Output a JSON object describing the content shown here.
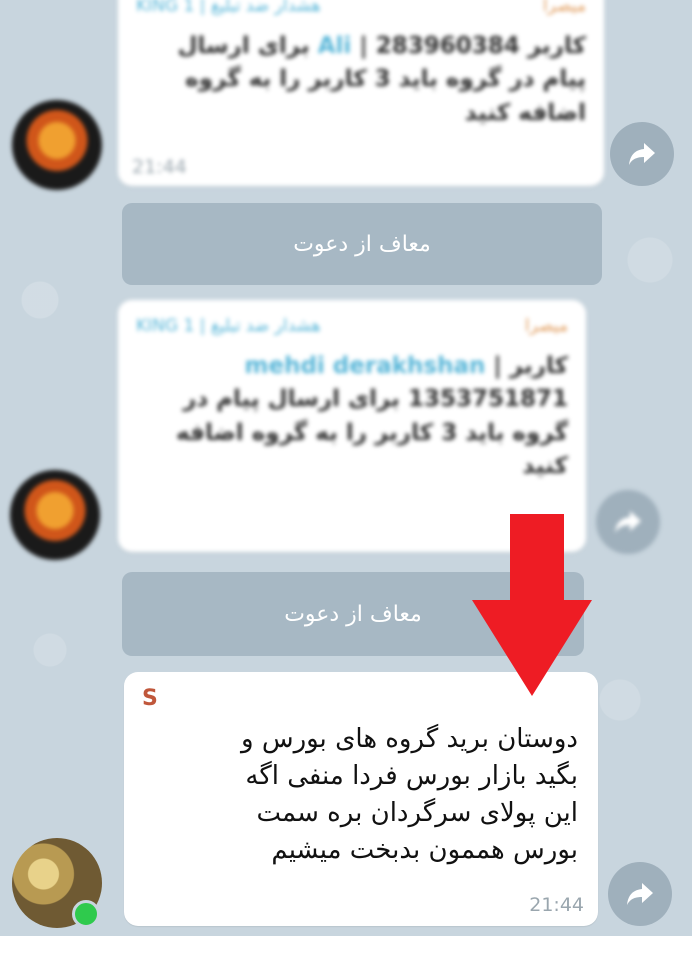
{
  "messages": [
    {
      "sender": "میصرا",
      "header_text": "هشدار ضد تبلیغ | KING 1",
      "text_prefix": "کاربر 283960384 |",
      "link_name": "Ali",
      "text_body": "برای ارسال پیام در گروه باید 3 کاربر را به گروه اضافه کنید",
      "time": "21:44"
    },
    {
      "sender": "میصرا",
      "header_text": "هشدار ضد تبلیغ | KING 1",
      "text_prefix": "کاربر |",
      "link_name": "mehdi derakhshan",
      "text_body": "1353751871 برای ارسال پیام در گروه باید 3 کاربر را به گروه اضافه کنید",
      "time": ""
    },
    {
      "sender": "S",
      "text": "دوستان برید گروه های بورس و بگید بازار بورس فردا منفی اگه این پولای سرگردان بره سمت بورس هممون بدبخت میشیم",
      "time": "21:44"
    }
  ],
  "service_messages": [
    "معاف از دعوت",
    "معاف از دعوت"
  ],
  "icons": {
    "share": "share-arrow-icon",
    "annotation": "red-down-arrow-icon"
  },
  "colors": {
    "wallpaper": "#c8d5de",
    "bubble": "#ffffff",
    "link": "#58b6d8",
    "sender_s": "#c0573b",
    "online": "#2fca4d",
    "arrow": "#ee1c24"
  }
}
